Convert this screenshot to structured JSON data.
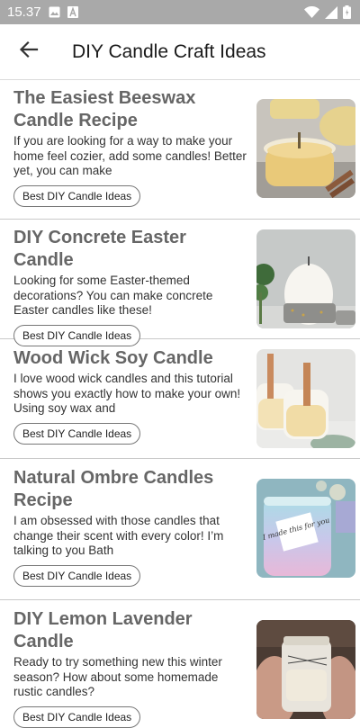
{
  "status_bar": {
    "time": "15.37",
    "icons": [
      "gallery-icon",
      "text-a-icon",
      "wifi-icon",
      "signal-icon",
      "battery-icon"
    ]
  },
  "app_bar": {
    "back_icon": "arrow-left-icon",
    "title": "DIY Candle Craft Ideas"
  },
  "articles": [
    {
      "title": "The Easiest Beeswax Candle Recipe",
      "description": "If you are looking for a way to make your home feel cozier, add some candles! Better yet, you can make",
      "tag": "Best DIY Candle Ideas",
      "image": "beeswax-candle-jars"
    },
    {
      "title": "DIY Concrete Easter Candle",
      "description": "Looking for some Easter-themed decorations? You can make concrete Easter candles like these!",
      "tag": "Best DIY Candle Ideas",
      "image": "concrete-egg-candle"
    },
    {
      "title": "Wood Wick Soy Candle",
      "description": "I love wood wick candles and this tutorial shows you exactly how to make your own! Using soy wax and",
      "tag": "Best DIY Candle Ideas",
      "image": "wood-wick-soy-candles"
    },
    {
      "title": "Natural Ombre Candles Recipe",
      "description": "I am obsessed with those candles that change their scent with every color! I’m talking to you Bath",
      "tag": "Best DIY Candle Ideas",
      "image": "ombre-candle-jar",
      "image_text": "I made this for you"
    },
    {
      "title": "DIY Lemon Lavender Candle",
      "description": "Ready to try something new this winter season? How about some homemade rustic candles?",
      "tag": "Best DIY Candle Ideas",
      "image": "lemon-lavender-candle-jar"
    }
  ]
}
